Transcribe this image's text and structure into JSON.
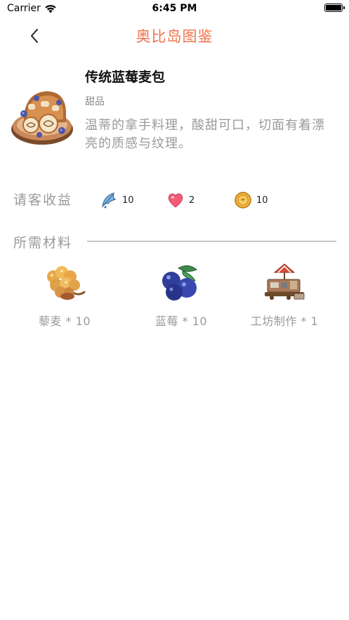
{
  "status_bar": {
    "carrier": "Carrier",
    "time": "6:45 PM",
    "battery_level": 1.0,
    "icons": [
      "wifi-icon",
      "battery-icon"
    ]
  },
  "nav": {
    "title": "奥比岛图鉴",
    "back_icon": "chevron-left-icon"
  },
  "item": {
    "name": "传统蓝莓麦包",
    "category": "甜品",
    "description": "温蒂的拿手料理，酸甜可口，切面有着漂亮的质感与纹理。",
    "image_icon": "blueberry-bread-icon"
  },
  "rewards": {
    "label": "请客收益",
    "items": [
      {
        "icon": "feather-icon",
        "value": "10"
      },
      {
        "icon": "heart-icon",
        "value": "2"
      },
      {
        "icon": "coin-icon",
        "value": "10"
      }
    ]
  },
  "materials": {
    "label": "所需材料",
    "items": [
      {
        "icon": "quinoa-icon",
        "label": "藜麦 * 10"
      },
      {
        "icon": "blueberry-icon",
        "label": "蓝莓 * 10"
      },
      {
        "icon": "workshop-icon",
        "label": "工坊制作 * 1"
      }
    ]
  },
  "colors": {
    "accent": "#f0714a",
    "muted_text": "#9a9a9a"
  }
}
